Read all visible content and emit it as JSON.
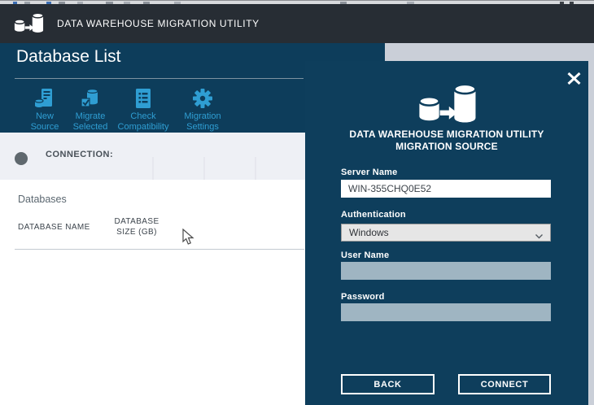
{
  "title_bar": {
    "app_title": "DATA WAREHOUSE MIGRATION UTILITY"
  },
  "main": {
    "page_title": "Database List",
    "toolbar": [
      {
        "line1": "New",
        "line2": "Source"
      },
      {
        "line1": "Migrate",
        "line2": "Selected"
      },
      {
        "line1": "Check",
        "line2": "Compatibility"
      },
      {
        "line1": "Migration",
        "line2": "Settings"
      }
    ],
    "connection": {
      "label": "CONNECTION:"
    },
    "databases": {
      "section_title": "Databases",
      "columns": [
        "DATABASE NAME",
        "DATABASE SIZE (GB)"
      ],
      "rows": []
    }
  },
  "dialog": {
    "title_line1": "DATA WAREHOUSE MIGRATION UTILITY",
    "title_line2": "MIGRATION SOURCE",
    "server_name": {
      "label": "Server Name",
      "value": "WIN-355CHQ0E52"
    },
    "authentication": {
      "label": "Authentication",
      "value": "Windows"
    },
    "user_name": {
      "label": "User Name",
      "value": ""
    },
    "password": {
      "label": "Password",
      "value": ""
    },
    "back_button": "BACK",
    "connect_button": "CONNECT"
  },
  "colors": {
    "accent_blue": "#2f9ed3",
    "window_navy": "#0e3e5c",
    "titlebar_gray": "#272d34",
    "disabled_field": "#9fb5c2",
    "connection_bar": "#eef0f5",
    "backdrop_gray": "#cacfd8"
  }
}
